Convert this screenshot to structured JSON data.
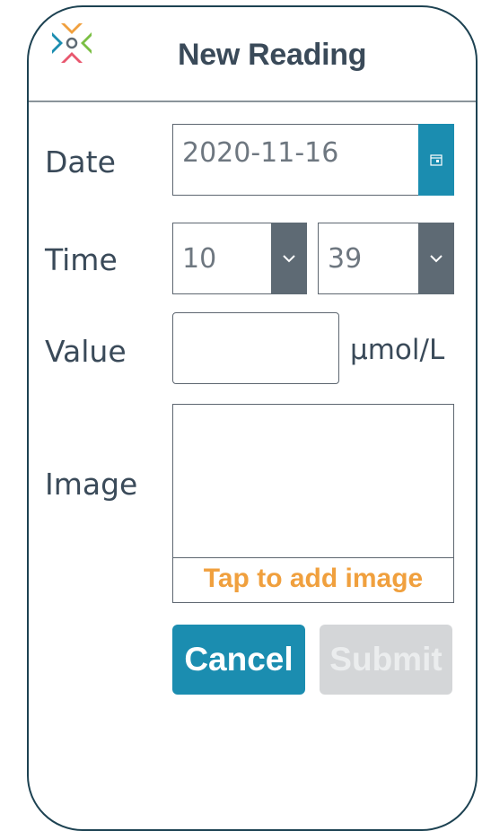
{
  "header": {
    "title": "New Reading",
    "logo_icon": "app-logo-icon"
  },
  "form": {
    "date": {
      "label": "Date",
      "value": "2020-11-16",
      "button_icon": "calendar-icon"
    },
    "time": {
      "label": "Time",
      "hour": "10",
      "minute": "39",
      "dropdown_icon": "chevron-down-icon"
    },
    "value": {
      "label": "Value",
      "input_value": "",
      "unit": "μmol/L"
    },
    "image": {
      "label": "Image",
      "tap_text": "Tap to add image"
    }
  },
  "actions": {
    "cancel_label": "Cancel",
    "submit_label": "Submit",
    "submit_disabled": true
  },
  "colors": {
    "accent": "#1b8db0",
    "border": "#1d4252",
    "text": "#3a4a59",
    "select_button": "#5e6a74",
    "tap_text": "#f0a03e",
    "disabled": "#d4d6d8"
  }
}
